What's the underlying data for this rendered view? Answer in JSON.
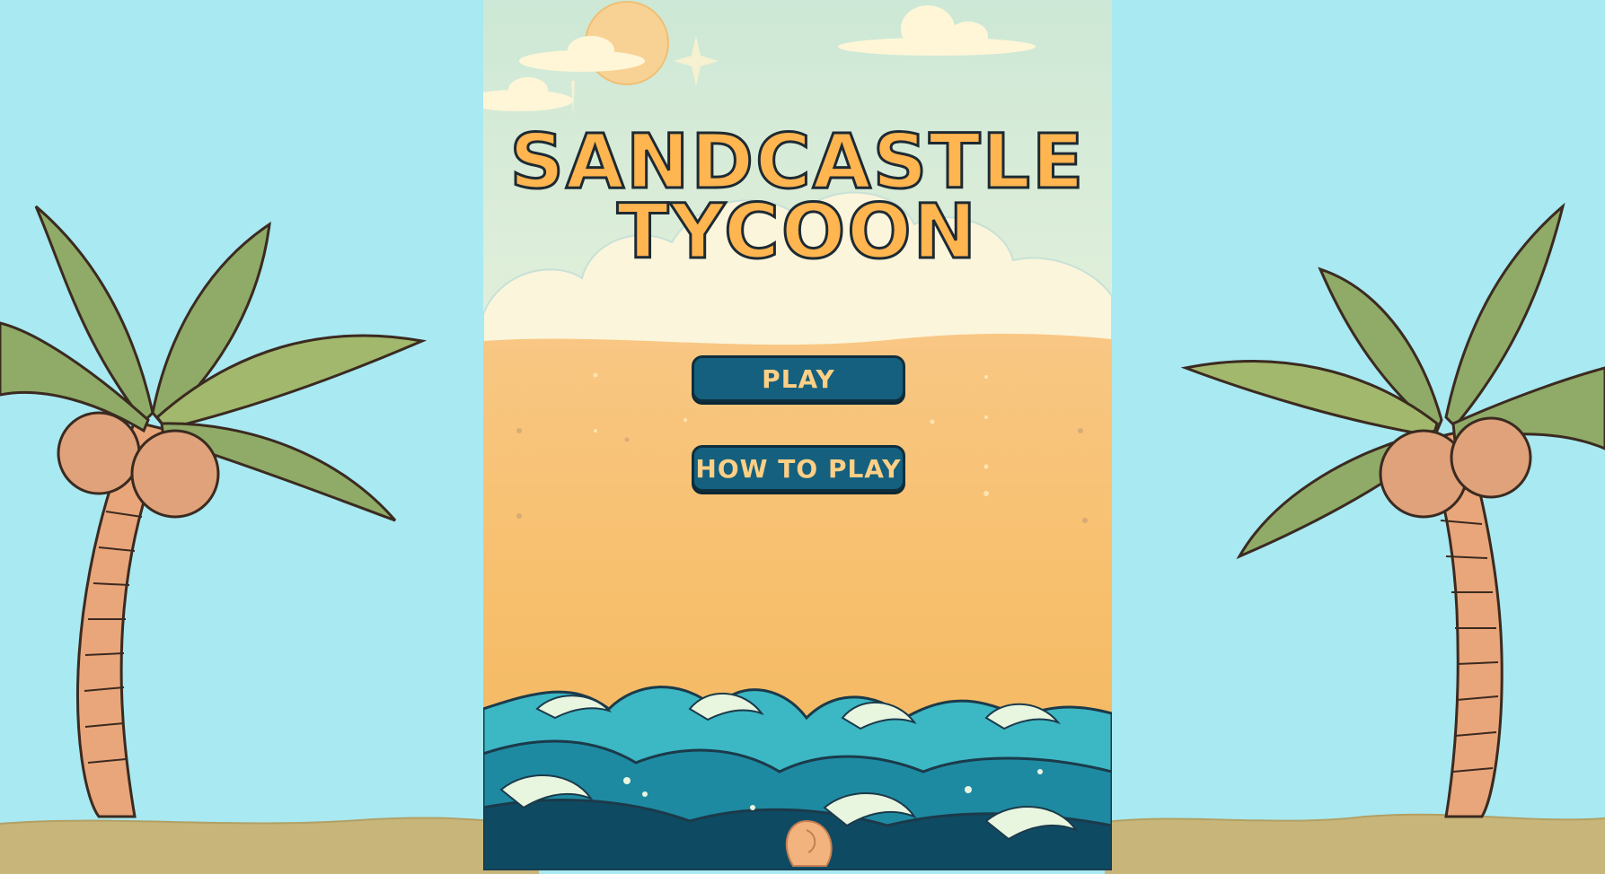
{
  "game": {
    "title_line1": "SANDCASTLE",
    "title_line2": "TYCOON"
  },
  "menu": {
    "play_label": "PLAY",
    "how_to_play_label": "HOW TO PLAY"
  },
  "colors": {
    "sky": "#a8e9f2",
    "sand": "#c7b57a",
    "title_fill": "#ffb550",
    "button_bg": "#14607e",
    "button_text": "#ffcf86",
    "ocean": "#3cb7c4"
  }
}
